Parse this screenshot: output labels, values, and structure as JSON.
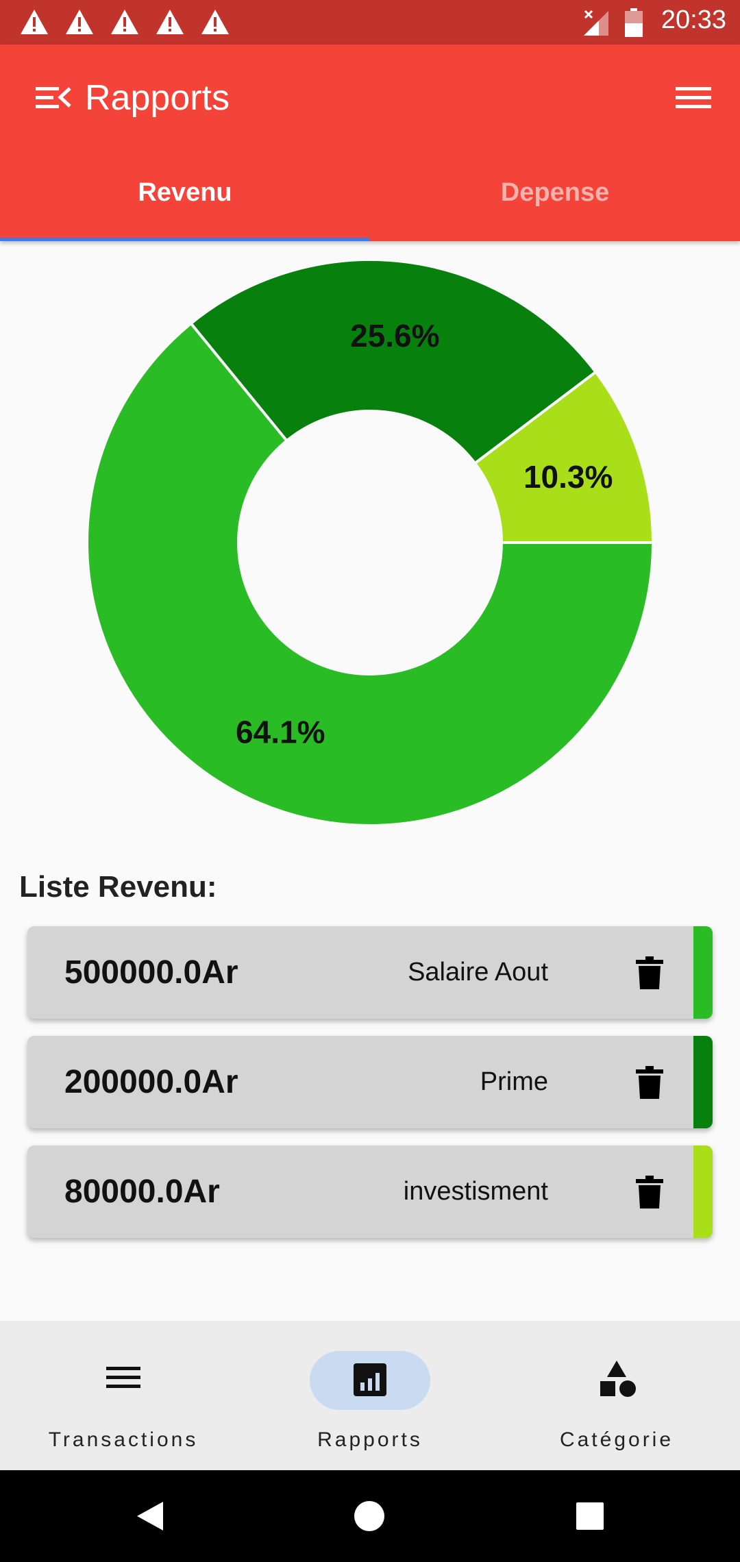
{
  "status_bar": {
    "time": "20:33",
    "notification_icons": [
      "warning-icon",
      "warning-icon",
      "warning-icon",
      "warning-icon",
      "warning-icon"
    ]
  },
  "app_bar": {
    "title": "Rapports",
    "left_icon": "menu-collapse-icon",
    "right_icon": "hamburger-menu-icon",
    "color": "#f4443a"
  },
  "tabs": [
    {
      "label": "Revenu",
      "selected": true
    },
    {
      "label": "Depense",
      "selected": false
    }
  ],
  "chart_data": {
    "type": "pie",
    "donut": true,
    "slices": [
      {
        "label": "64.1%",
        "value": 64.1,
        "color": "#29bc25"
      },
      {
        "label": "25.6%",
        "value": 25.6,
        "color": "#08800e"
      },
      {
        "label": "10.3%",
        "value": 10.3,
        "color": "#a8df18"
      }
    ],
    "title": "",
    "legend": "none"
  },
  "list": {
    "title": "Liste Revenu:",
    "items": [
      {
        "amount": "500000.0Ar",
        "label": "Salaire Aout",
        "color": "#29bc25",
        "action_icon": "trash-icon"
      },
      {
        "amount": "200000.0Ar",
        "label": "Prime",
        "color": "#08800e",
        "action_icon": "trash-icon"
      },
      {
        "amount": "80000.0Ar",
        "label": "investisment",
        "color": "#a8df18",
        "action_icon": "trash-icon"
      }
    ]
  },
  "bottom_nav": [
    {
      "label": "Transactions",
      "icon": "list-icon",
      "active": false
    },
    {
      "label": "Rapports",
      "icon": "bar-chart-icon",
      "active": true
    },
    {
      "label": "Catégorie",
      "icon": "shapes-icon",
      "active": false
    }
  ],
  "system_nav": [
    "back-icon",
    "home-icon",
    "recents-icon"
  ]
}
